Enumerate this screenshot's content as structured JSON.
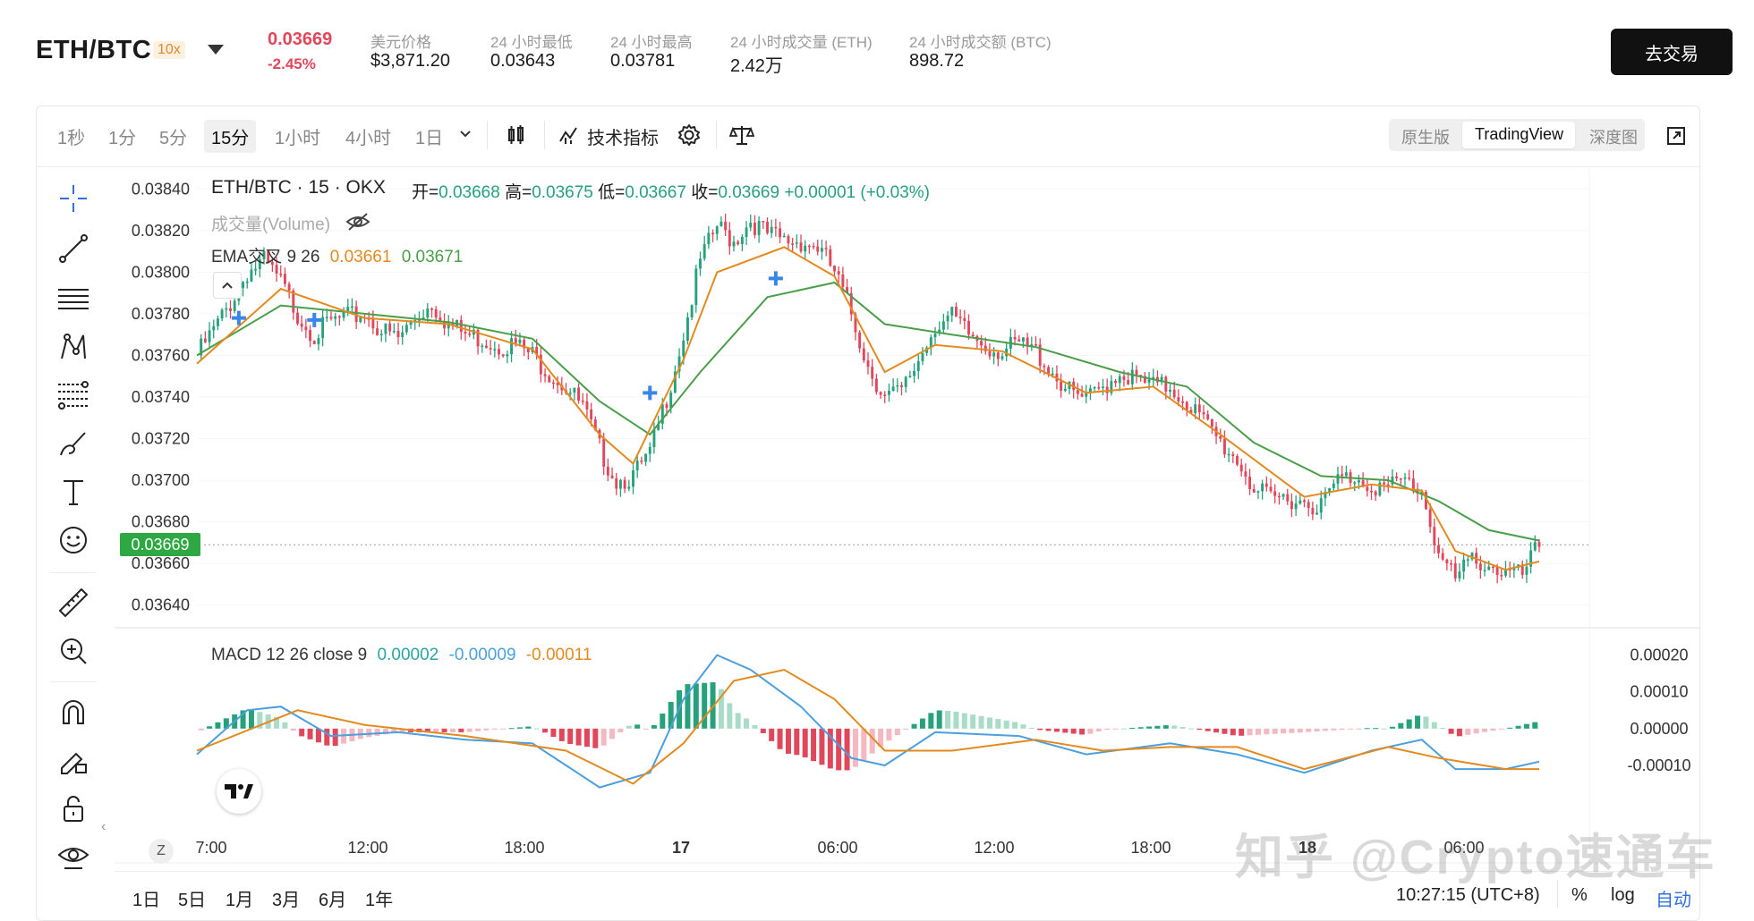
{
  "header": {
    "pair": "ETH/BTC",
    "leverage": "10x",
    "last_price": "0.03669",
    "change_pct": "-2.45%",
    "stats": [
      {
        "label": "美元价格",
        "value": "$3,871.20"
      },
      {
        "label": "24 小时最低",
        "value": "0.03643"
      },
      {
        "label": "24 小时最高",
        "value": "0.03781"
      },
      {
        "label": "24 小时成交量 (ETH)",
        "value": "2.42万"
      },
      {
        "label": "24 小时成交额 (BTC)",
        "value": "898.72"
      }
    ],
    "trade_button": "去交易"
  },
  "toolbar": {
    "intervals": [
      "1秒",
      "1分",
      "5分",
      "15分",
      "4小时",
      "1日"
    ],
    "interval_1h": "1小时",
    "active_interval": "15分",
    "indicators_label": "技术指标",
    "views": [
      "原生版",
      "TradingView",
      "深度图"
    ],
    "active_view": "TradingView"
  },
  "legend": {
    "symbol_line": "ETH/BTC · 15 · OKX",
    "open_label": "开=",
    "open": "0.03668",
    "high_label": "高=",
    "high": "0.03675",
    "low_label": "低=",
    "low": "0.03667",
    "close_label": "收=",
    "close": "0.03669",
    "change": "+0.00001 (+0.03%)",
    "volume_label": "成交量(Volume)",
    "ema_label": "EMA交叉 9 26",
    "ema_fast": "0.03661",
    "ema_slow": "0.03671",
    "macd_label": "MACD 12 26 close 9",
    "macd_hist": "0.00002",
    "macd_line": "-0.00009",
    "macd_signal": "-0.00011"
  },
  "bottom": {
    "ranges": [
      "1日",
      "5日",
      "1月",
      "3月",
      "6月",
      "1年"
    ],
    "time": "10:27:15 (UTC+8)",
    "pct": "%",
    "log": "log",
    "auto": "自动",
    "z": "Z"
  },
  "watermark": "知乎 @Crypto速通车",
  "colors": {
    "up": "#26a17b",
    "down": "#e0475a",
    "ema_fast": "#e38a1f",
    "ema_slow": "#4a9e4a",
    "macd": "#4b9fde",
    "signal": "#e38a1f"
  },
  "chart_data": {
    "type": "candlestick",
    "title": "ETH/BTC · 15 · OKX",
    "current_price": 0.03669,
    "ylim": [
      0.0363,
      0.0385
    ],
    "yticks": [
      0.0384,
      0.0382,
      0.038,
      0.0378,
      0.0376,
      0.0374,
      0.0372,
      0.037,
      0.0368,
      0.0366,
      0.0364
    ],
    "xticks": [
      "7:00",
      "12:00",
      "18:00",
      "17",
      "06:00",
      "12:00",
      "18:00",
      "18",
      "06:00"
    ],
    "close_path": [
      [
        0,
        0.0376
      ],
      [
        4,
        0.03772
      ],
      [
        8,
        0.03785
      ],
      [
        12,
        0.038
      ],
      [
        16,
        0.03805
      ],
      [
        20,
        0.03795
      ],
      [
        24,
        0.0378
      ],
      [
        28,
        0.0377
      ],
      [
        32,
        0.03776
      ],
      [
        36,
        0.03778
      ],
      [
        40,
        0.0378
      ],
      [
        44,
        0.03772
      ],
      [
        48,
        0.03768
      ],
      [
        52,
        0.03778
      ],
      [
        56,
        0.03785
      ],
      [
        60,
        0.03775
      ],
      [
        64,
        0.0377
      ],
      [
        68,
        0.03768
      ],
      [
        72,
        0.03765
      ],
      [
        76,
        0.03765
      ],
      [
        80,
        0.0376
      ],
      [
        84,
        0.03752
      ],
      [
        88,
        0.03745
      ],
      [
        92,
        0.03735
      ],
      [
        96,
        0.03715
      ],
      [
        100,
        0.037
      ],
      [
        104,
        0.03702
      ],
      [
        108,
        0.03712
      ],
      [
        112,
        0.0374
      ],
      [
        116,
        0.0377
      ],
      [
        120,
        0.03805
      ],
      [
        124,
        0.03822
      ],
      [
        128,
        0.03815
      ],
      [
        132,
        0.03825
      ],
      [
        136,
        0.03818
      ],
      [
        140,
        0.03815
      ],
      [
        144,
        0.03815
      ],
      [
        148,
        0.03812
      ],
      [
        152,
        0.038
      ],
      [
        156,
        0.0378
      ],
      [
        160,
        0.03755
      ],
      [
        164,
        0.0374
      ],
      [
        168,
        0.03742
      ],
      [
        172,
        0.03758
      ],
      [
        176,
        0.03775
      ],
      [
        180,
        0.03778
      ],
      [
        184,
        0.0377
      ],
      [
        188,
        0.03765
      ],
      [
        192,
        0.03762
      ],
      [
        196,
        0.03765
      ],
      [
        200,
        0.03762
      ],
      [
        204,
        0.03752
      ],
      [
        208,
        0.03742
      ],
      [
        212,
        0.03738
      ],
      [
        216,
        0.03745
      ],
      [
        220,
        0.03752
      ],
      [
        224,
        0.03748
      ],
      [
        228,
        0.03745
      ],
      [
        232,
        0.03745
      ],
      [
        236,
        0.03738
      ],
      [
        240,
        0.03728
      ],
      [
        244,
        0.03718
      ],
      [
        248,
        0.0371
      ],
      [
        252,
        0.03696
      ],
      [
        256,
        0.0369
      ],
      [
        260,
        0.03692
      ],
      [
        264,
        0.0369
      ],
      [
        268,
        0.03688
      ],
      [
        272,
        0.037
      ],
      [
        276,
        0.03702
      ],
      [
        280,
        0.03698
      ],
      [
        284,
        0.03696
      ],
      [
        288,
        0.037
      ],
      [
        292,
        0.03695
      ],
      [
        296,
        0.03665
      ],
      [
        300,
        0.03652
      ],
      [
        304,
        0.03662
      ],
      [
        308,
        0.0366
      ],
      [
        312,
        0.03655
      ],
      [
        316,
        0.03654
      ],
      [
        320,
        0.03669
      ]
    ],
    "ema_fast": [
      [
        0,
        0.03756
      ],
      [
        20,
        0.03792
      ],
      [
        40,
        0.03778
      ],
      [
        60,
        0.03775
      ],
      [
        80,
        0.03763
      ],
      [
        96,
        0.03722
      ],
      [
        104,
        0.03708
      ],
      [
        116,
        0.03758
      ],
      [
        124,
        0.038
      ],
      [
        140,
        0.03812
      ],
      [
        152,
        0.03798
      ],
      [
        164,
        0.03752
      ],
      [
        176,
        0.03765
      ],
      [
        192,
        0.03762
      ],
      [
        212,
        0.03742
      ],
      [
        228,
        0.03745
      ],
      [
        244,
        0.03722
      ],
      [
        264,
        0.03692
      ],
      [
        280,
        0.03698
      ],
      [
        292,
        0.03695
      ],
      [
        300,
        0.03666
      ],
      [
        312,
        0.03657
      ],
      [
        320,
        0.03661
      ]
    ],
    "ema_slow": [
      [
        0,
        0.0376
      ],
      [
        20,
        0.03784
      ],
      [
        40,
        0.0378
      ],
      [
        60,
        0.03776
      ],
      [
        80,
        0.03768
      ],
      [
        96,
        0.03738
      ],
      [
        108,
        0.03722
      ],
      [
        120,
        0.03752
      ],
      [
        136,
        0.03788
      ],
      [
        152,
        0.03795
      ],
      [
        164,
        0.03775
      ],
      [
        180,
        0.0377
      ],
      [
        200,
        0.03764
      ],
      [
        220,
        0.03752
      ],
      [
        236,
        0.03745
      ],
      [
        252,
        0.03718
      ],
      [
        268,
        0.03702
      ],
      [
        284,
        0.037
      ],
      [
        296,
        0.0369
      ],
      [
        308,
        0.03676
      ],
      [
        320,
        0.03671
      ]
    ],
    "crossovers": [
      [
        10,
        0.03778
      ],
      [
        28,
        0.03777
      ],
      [
        108,
        0.03742
      ],
      [
        138,
        0.03797
      ]
    ],
    "macd": {
      "ylim": [
        -0.00028,
        0.00025
      ],
      "yticks": [
        0.0002,
        0.0001,
        0.0,
        -0.0001
      ],
      "macd_line": [
        [
          0,
          -7e-05
        ],
        [
          12,
          5e-05
        ],
        [
          20,
          6e-05
        ],
        [
          32,
          -2e-05
        ],
        [
          48,
          -1e-05
        ],
        [
          64,
          -3e-05
        ],
        [
          80,
          -4e-05
        ],
        [
          96,
          -0.00016
        ],
        [
          108,
          -0.00012
        ],
        [
          116,
          8e-05
        ],
        [
          124,
          0.0002
        ],
        [
          132,
          0.00016
        ],
        [
          144,
          6e-05
        ],
        [
          156,
          -8e-05
        ],
        [
          164,
          -0.0001
        ],
        [
          176,
          -1e-05
        ],
        [
          196,
          -2e-05
        ],
        [
          212,
          -7e-05
        ],
        [
          232,
          -4e-05
        ],
        [
          248,
          -7e-05
        ],
        [
          264,
          -0.00012
        ],
        [
          280,
          -6e-05
        ],
        [
          292,
          -3e-05
        ],
        [
          300,
          -0.00011
        ],
        [
          312,
          -0.00011
        ],
        [
          320,
          -9e-05
        ]
      ],
      "signal_line": [
        [
          0,
          -6e-05
        ],
        [
          24,
          5e-05
        ],
        [
          40,
          1e-05
        ],
        [
          64,
          -2e-05
        ],
        [
          88,
          -6e-05
        ],
        [
          104,
          -0.00015
        ],
        [
          116,
          -4e-05
        ],
        [
          128,
          0.00013
        ],
        [
          140,
          0.00016
        ],
        [
          152,
          8e-05
        ],
        [
          164,
          -6e-05
        ],
        [
          180,
          -6e-05
        ],
        [
          200,
          -3e-05
        ],
        [
          216,
          -6e-05
        ],
        [
          232,
          -5e-05
        ],
        [
          248,
          -5e-05
        ],
        [
          264,
          -0.00011
        ],
        [
          284,
          -5e-05
        ],
        [
          296,
          -8e-05
        ],
        [
          312,
          -0.00011
        ],
        [
          320,
          -0.00011
        ]
      ]
    }
  }
}
